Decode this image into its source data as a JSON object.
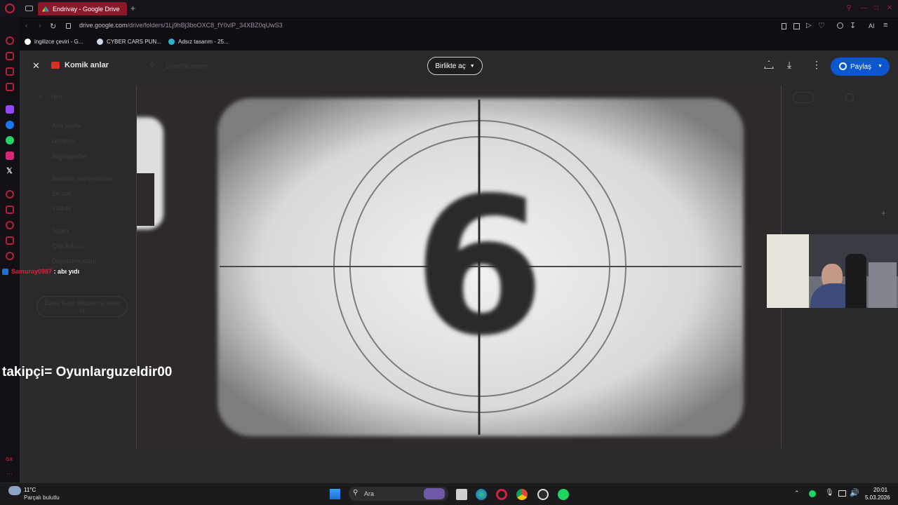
{
  "browser": {
    "tab_title": "Endrivay - Google Drive",
    "new_tab_glyph": "+",
    "url_domain": "drive.google.com",
    "url_path": "/drive/folders/1Lj9hBj3boOXC8_fY0vlP_34XBZ0qUwS3",
    "ai_label": "AI",
    "bookmarks": [
      {
        "label": "ingilizce çeviri - G...",
        "icon": "google-icon"
      },
      {
        "label": "CYBER CARS PUN...",
        "icon": "bookmark-icon"
      },
      {
        "label": "Adsız tasarım - 25...",
        "icon": "canva-icon"
      }
    ]
  },
  "viewer": {
    "title": "Komik anlar",
    "open_with_label": "Birlikte aç",
    "share_label": "Paylaş",
    "search_placeholder": "Drive'da arayın",
    "faded_sidebar": [
      "Yeni",
      "Ana sayfa",
      "Drive'ım",
      "Bilgisayarlar",
      "Benimle paylaşılanlar",
      "En son",
      "Yıldızlı",
      "Spam",
      "Çöp kutusu",
      "Depolama alanı",
      "Daha fazla depolama alanı al"
    ],
    "countdown_digit": "6"
  },
  "overlays": {
    "chat_user": "Samuray0987",
    "chat_message": ": abı yıdı",
    "follower_text": "takipçi= Oyunlarguzeldir00"
  },
  "taskbar": {
    "weather_temp": "11°C",
    "weather_desc": "Parçalı bulutlu",
    "search_label": "Ara",
    "time": "20:01",
    "date": "5.03.2026"
  },
  "colors": {
    "accent": "#a3203a",
    "share_blue": "#0b57d0",
    "tab_red": "#8a1a2b"
  }
}
